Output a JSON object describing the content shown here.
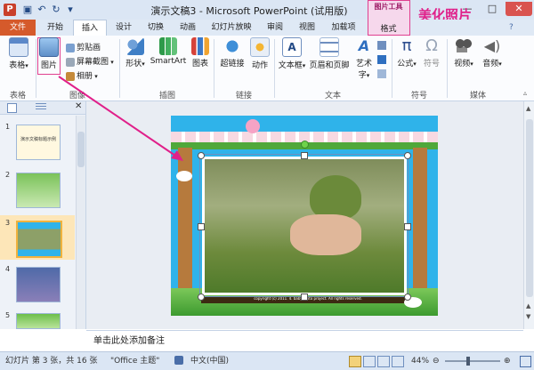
{
  "window": {
    "title": "演示文稿3 - Microsoft PowerPoint (试用版)",
    "minimize": "—",
    "maximize": "□",
    "close": "✕"
  },
  "tabs": [
    "文件",
    "开始",
    "插入",
    "设计",
    "切换",
    "动画",
    "幻灯片放映",
    "审阅",
    "视图",
    "加载项"
  ],
  "context_tab": {
    "header": "图片工具",
    "label": "格式"
  },
  "annotation": "美化照片",
  "ribbon": {
    "table": {
      "label": "表格",
      "group": "表格"
    },
    "image_group": {
      "picture": "图片",
      "clipart": "剪贴画",
      "screenshot": "屏幕截图",
      "album": "相册",
      "group": "图像"
    },
    "illustrations": {
      "shapes": "形状",
      "smartart": "SmartArt",
      "chart": "图表",
      "group": "插图"
    },
    "links": {
      "hyperlink": "超链接",
      "action": "动作",
      "group": "链接"
    },
    "text": {
      "textbox": "文本框",
      "header_footer": "页眉和页脚",
      "wordart": "艺术字",
      "group": "文本"
    },
    "symbols": {
      "equation": "公式",
      "symbol": "符号",
      "group": "符号"
    },
    "media": {
      "video": "视频",
      "audio": "音频",
      "group": "媒体"
    }
  },
  "slides": {
    "numbers": [
      "1",
      "2",
      "3",
      "4",
      "5"
    ],
    "slide1_title": "演示文稿标题示例"
  },
  "slide": {
    "copyright": "copyright (c) 2011. 4. babyphoto project. All rights reserved."
  },
  "notes_placeholder": "单击此处添加备注",
  "status": {
    "slide_info": "幻灯片 第 3 张，共 16 张",
    "theme": "\"Office 主题\"",
    "language": "中文(中国)",
    "zoom": "44%"
  },
  "colors": {
    "annotation": "#e0208a",
    "file_tab": "#d55a2b",
    "slide_bg": "#2fb3ea"
  }
}
